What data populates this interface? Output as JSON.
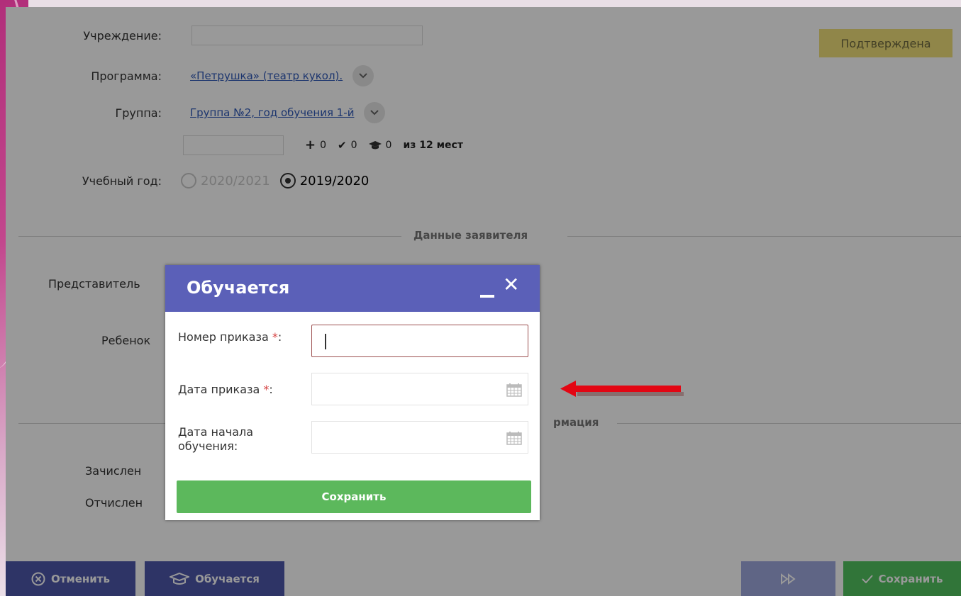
{
  "form": {
    "institution_label": "Учреждение:",
    "program_label": "Программа:",
    "program_value": "«Петрушка» (театр кукол).",
    "group_label": "Группа:",
    "group_value": "Группа №2, год обучения 1-й",
    "stats": {
      "plus_value": "0",
      "check_value": "0",
      "cap_value": "0",
      "capacity_text": "из 12 мест"
    },
    "year_label": "Учебный год:",
    "year_options": [
      "2020/2021",
      "2019/2020"
    ],
    "year_selected": "2019/2020",
    "status_badge": "Подтверждена",
    "section_applicant": "Данные заявителя",
    "representative_label": "Представитель",
    "child_label": "Ребенок",
    "section_info_partial": "рмация",
    "enrolled_label": "Зачислен",
    "expelled_label": "Отчислен"
  },
  "bottom_bar": {
    "cancel_label": "Отменить",
    "learning_label": "Обучается",
    "save_label": "Сохранить"
  },
  "modal": {
    "title": "Обучается",
    "order_number_label": "Номер приказа",
    "order_date_label": "Дата приказа",
    "start_date_label": "Дата начала обучения:",
    "required_mark": "*",
    "save_label": "Сохранить",
    "order_number_value": "",
    "order_date_value": "",
    "start_date_value": ""
  },
  "icons": {
    "chevron": "chevron-down-icon",
    "calendar": "calendar-icon",
    "close": "close-icon",
    "minimize": "minimize-icon",
    "cancel": "cancel-circle-icon",
    "cap": "graduation-cap-icon",
    "fast_forward": "fast-forward-icon",
    "check": "check-icon",
    "arrow": "red-arrow-icon"
  },
  "colors": {
    "header_accent": "#5b60b8",
    "primary_button": "#4e57aa",
    "save_green": "#53c35f",
    "modal_save": "#5cb85c",
    "status_badge": "#f1e07a",
    "required": "#d64545",
    "arrow_red": "#e30613"
  }
}
